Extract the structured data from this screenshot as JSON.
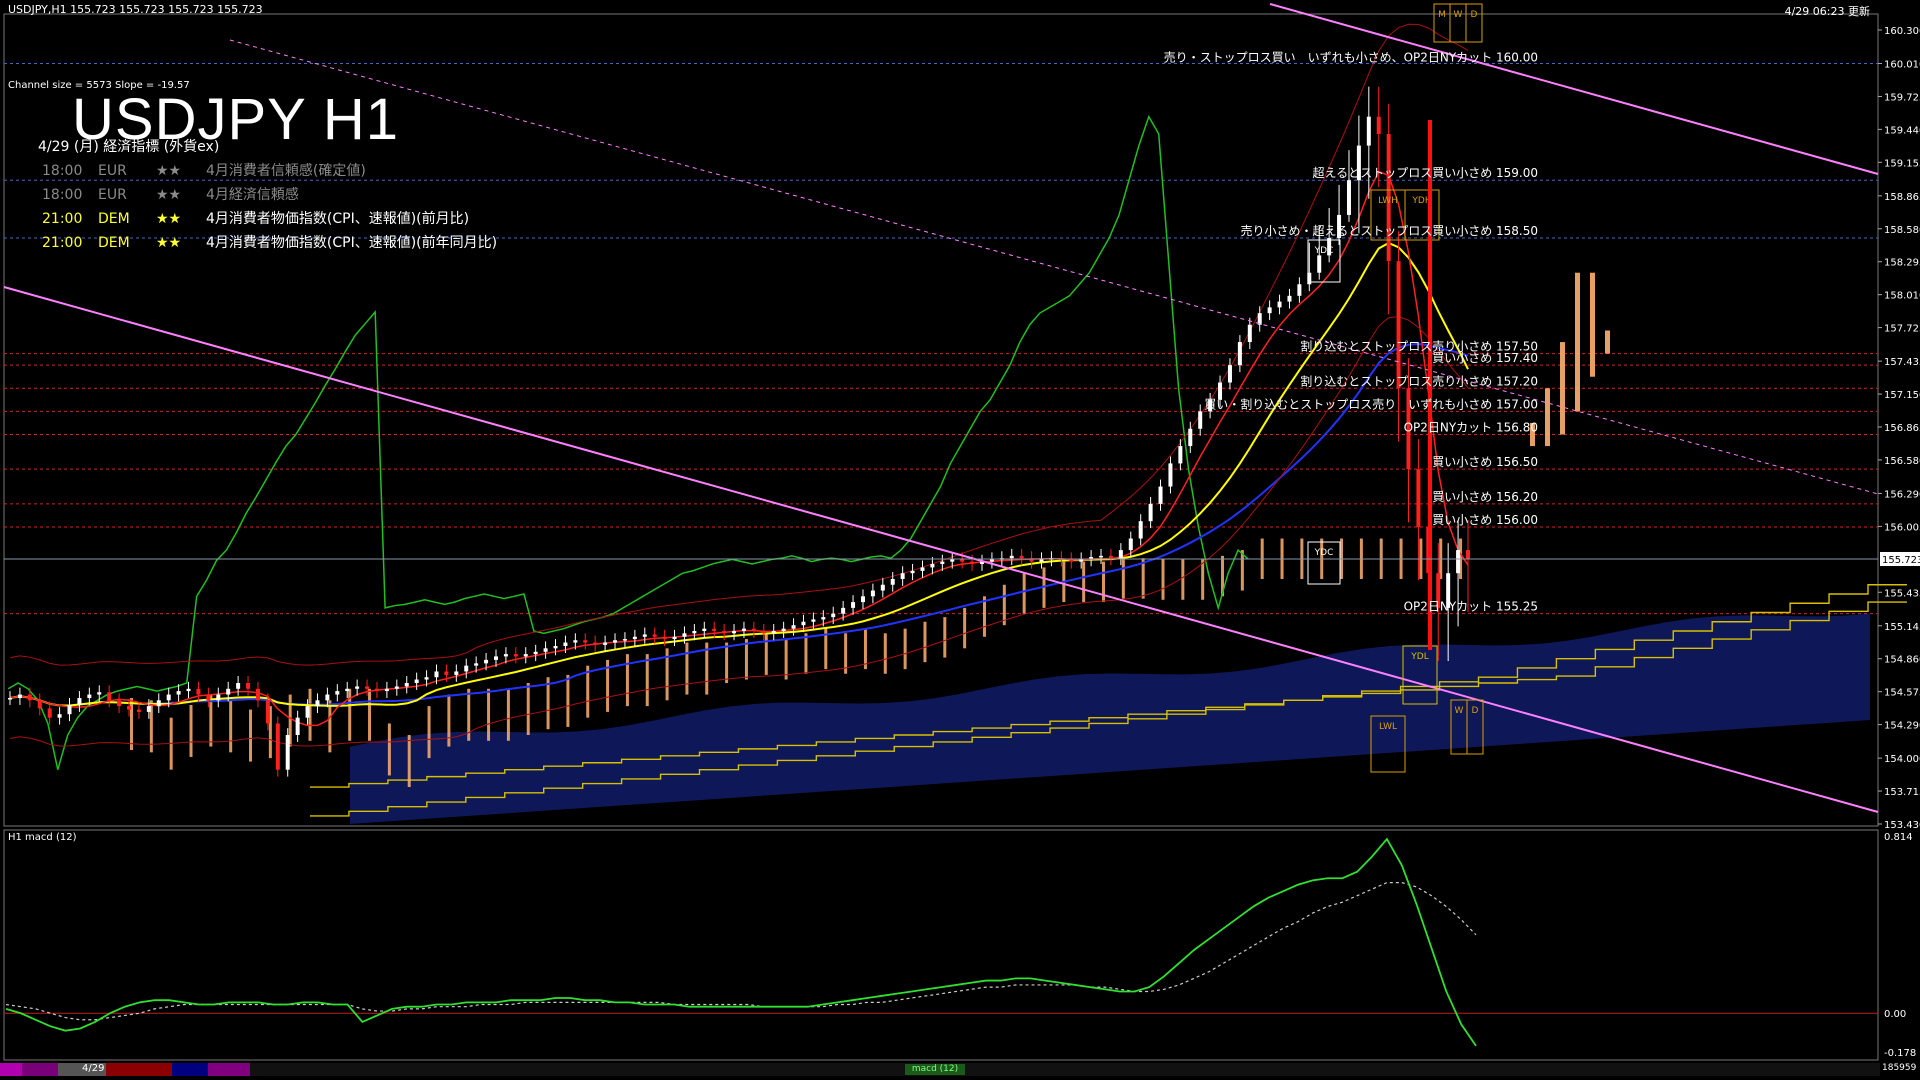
{
  "header": {
    "symbol_info": "USDJPY,H1  155.723 155.723 155.723 155.723",
    "updated": "4/29 06:23 更新"
  },
  "channel_info": "Channel size = 5573 Slope = -19.57",
  "title": "USDJPY H1",
  "calendar": {
    "date_label": "4/29 (月) 経済指標 (外貨ex)",
    "events": [
      {
        "time": "18:00",
        "currency": "EUR",
        "stars": "★★",
        "title": "4月消費者信頼感(確定値)",
        "style": "gray"
      },
      {
        "time": "18:00",
        "currency": "EUR",
        "stars": "★★",
        "title": "4月経済信頼感",
        "style": "gray"
      },
      {
        "time": "21:00",
        "currency": "DEM",
        "stars": "★★",
        "title": "4月消費者物価指数(CPI、速報値)(前月比)",
        "style": "yellow"
      },
      {
        "time": "21:00",
        "currency": "DEM",
        "stars": "★★",
        "title": "4月消費者物価指数(CPI、速報値)(前年同月比)",
        "style": "yellow"
      }
    ]
  },
  "chart_data": {
    "type": "line",
    "price_axis": {
      "ticks": [
        "160.300",
        "160.010",
        "159.725",
        "159.440",
        "159.155",
        "158.865",
        "158.580",
        "158.295",
        "158.010",
        "157.725",
        "157.435",
        "157.150",
        "156.865",
        "156.580",
        "156.290",
        "156.005",
        "155.723",
        "155.435",
        "155.145",
        "154.860",
        "154.575",
        "154.290",
        "154.000",
        "153.715",
        "153.430"
      ],
      "range": [
        153.43,
        160.3
      ],
      "current_price": "155.723"
    },
    "annotations": [
      {
        "text": "売り・ストップロス買い　いずれも小さめ、OP2日NYカット 160.00",
        "price": 160.0
      },
      {
        "text": "超えるとストップロス買い小さめ 159.00",
        "price": 159.0
      },
      {
        "text": "売り小さめ・超えるとストップロス買い小さめ 158.50",
        "price": 158.5
      },
      {
        "text": "割り込むとストップロス売り小さめ 157.50",
        "price": 157.5
      },
      {
        "text": "買い小さめ 157.40",
        "price": 157.4
      },
      {
        "text": "割り込むとストップロス売り小さめ 157.20",
        "price": 157.2
      },
      {
        "text": "買い・割り込むとストップロス売り　いずれも小さめ 157.00",
        "price": 157.0
      },
      {
        "text": "OP2日NYカット 156.80",
        "price": 156.8
      },
      {
        "text": "買い小さめ 156.50",
        "price": 156.5
      },
      {
        "text": "買い小さめ 156.20",
        "price": 156.2
      },
      {
        "text": "買い小さめ 156.00",
        "price": 156.0
      },
      {
        "text": "OP2日NYカット 155.25",
        "price": 155.25
      }
    ],
    "level_boxes": [
      "YDC",
      "YDC",
      "LWH",
      "YDH",
      "YDL",
      "LWL",
      "W",
      "D",
      "M",
      "W",
      "D"
    ],
    "dashed_levels": [
      157.5,
      157.4,
      157.2,
      157.0,
      156.8,
      156.5,
      156.2,
      156.0,
      155.25
    ],
    "close": [
      154.52,
      154.55,
      154.5,
      154.43,
      154.35,
      154.38,
      154.46,
      154.52,
      154.55,
      154.57,
      154.5,
      154.45,
      154.42,
      154.4,
      154.45,
      154.5,
      154.55,
      154.58,
      154.6,
      154.55,
      154.5,
      154.55,
      154.6,
      154.65,
      154.6,
      154.5,
      154.3,
      153.9,
      154.2,
      154.35,
      154.45,
      154.5,
      154.55,
      154.58,
      154.6,
      154.62,
      154.6,
      154.58,
      154.6,
      154.62,
      154.65,
      154.68,
      154.7,
      154.75,
      154.72,
      154.75,
      154.8,
      154.82,
      154.85,
      154.88,
      154.9,
      154.88,
      154.9,
      154.92,
      154.95,
      154.97,
      155.0,
      155.02,
      155.0,
      154.98,
      155.0,
      155.02,
      155.03,
      155.05,
      155.07,
      155.05,
      155.03,
      155.05,
      155.08,
      155.1,
      155.12,
      155.1,
      155.08,
      155.1,
      155.12,
      155.1,
      155.08,
      155.1,
      155.12,
      155.15,
      155.18,
      155.2,
      155.22,
      155.25,
      155.3,
      155.35,
      155.4,
      155.45,
      155.5,
      155.55,
      155.6,
      155.62,
      155.65,
      155.68,
      155.7,
      155.72,
      155.7,
      155.68,
      155.7,
      155.72,
      155.73,
      155.75,
      155.73,
      155.7,
      155.72,
      155.73,
      155.72,
      155.7,
      155.72,
      155.74,
      155.75,
      155.73,
      155.8,
      155.9,
      156.05,
      156.2,
      156.35,
      156.55,
      156.7,
      156.85,
      157.0,
      157.1,
      157.25,
      157.4,
      157.6,
      157.75,
      157.85,
      157.9,
      157.95,
      158.0,
      158.1,
      158.2,
      158.35,
      158.5,
      158.7,
      159.0,
      159.3,
      159.55,
      159.4,
      158.3,
      157.2,
      156.5,
      156.0,
      155.6,
      155.3,
      155.6,
      155.8,
      155.723
    ],
    "macd": {
      "range": [
        -0.178,
        0.814
      ],
      "ticks": [
        "0.814",
        "0.00",
        "-0.178"
      ],
      "main": [
        0.02,
        0.0,
        -0.03,
        -0.06,
        -0.08,
        -0.07,
        -0.04,
        0.0,
        0.03,
        0.05,
        0.06,
        0.06,
        0.05,
        0.04,
        0.04,
        0.05,
        0.05,
        0.05,
        0.04,
        0.04,
        0.05,
        0.05,
        0.04,
        0.04,
        -0.04,
        -0.01,
        0.02,
        0.03,
        0.03,
        0.04,
        0.04,
        0.05,
        0.05,
        0.05,
        0.06,
        0.06,
        0.06,
        0.07,
        0.07,
        0.06,
        0.06,
        0.05,
        0.05,
        0.04,
        0.04,
        0.04,
        0.03,
        0.03,
        0.03,
        0.03,
        0.03,
        0.03,
        0.03,
        0.03,
        0.03,
        0.04,
        0.05,
        0.06,
        0.07,
        0.08,
        0.09,
        0.1,
        0.11,
        0.12,
        0.13,
        0.14,
        0.15,
        0.15,
        0.16,
        0.16,
        0.15,
        0.14,
        0.13,
        0.12,
        0.11,
        0.1,
        0.1,
        0.12,
        0.17,
        0.23,
        0.29,
        0.34,
        0.39,
        0.44,
        0.49,
        0.53,
        0.56,
        0.59,
        0.61,
        0.62,
        0.62,
        0.65,
        0.72,
        0.8,
        0.68,
        0.5,
        0.3,
        0.1,
        -0.05,
        -0.15
      ],
      "signal": [
        0.04,
        0.03,
        0.02,
        0.0,
        -0.02,
        -0.03,
        -0.03,
        -0.02,
        -0.01,
        0.0,
        0.02,
        0.03,
        0.04,
        0.04,
        0.04,
        0.04,
        0.04,
        0.04,
        0.04,
        0.04,
        0.04,
        0.04,
        0.04,
        0.04,
        0.02,
        0.01,
        0.01,
        0.02,
        0.02,
        0.03,
        0.03,
        0.03,
        0.04,
        0.04,
        0.04,
        0.05,
        0.05,
        0.05,
        0.05,
        0.05,
        0.05,
        0.05,
        0.05,
        0.05,
        0.05,
        0.04,
        0.04,
        0.04,
        0.04,
        0.04,
        0.04,
        0.03,
        0.03,
        0.03,
        0.03,
        0.03,
        0.04,
        0.04,
        0.05,
        0.05,
        0.06,
        0.07,
        0.08,
        0.09,
        0.1,
        0.11,
        0.12,
        0.12,
        0.13,
        0.13,
        0.13,
        0.13,
        0.13,
        0.12,
        0.12,
        0.11,
        0.1,
        0.1,
        0.11,
        0.13,
        0.16,
        0.19,
        0.23,
        0.27,
        0.31,
        0.35,
        0.39,
        0.42,
        0.46,
        0.49,
        0.51,
        0.54,
        0.57,
        0.6,
        0.6,
        0.58,
        0.54,
        0.49,
        0.43,
        0.36
      ]
    }
  },
  "footer": {
    "date_tab": "4/29",
    "macd_tab": "macd (12)",
    "macd_label": "H1  macd (12)",
    "volume": "185959"
  },
  "colors": {
    "background": "#000000",
    "candle_up": "#ffffff",
    "candle_down": "#ff2020",
    "ma_fast": "#ff2020",
    "ma_mid": "#ffff00",
    "ma_slow": "#2233ff",
    "chikou": "#20c020",
    "cloud": "#ffb070",
    "kumo_blue": "#1a2aa0",
    "channel": "#ff80ff",
    "level_red": "#dd2020",
    "level_blue": "#4466cc"
  }
}
